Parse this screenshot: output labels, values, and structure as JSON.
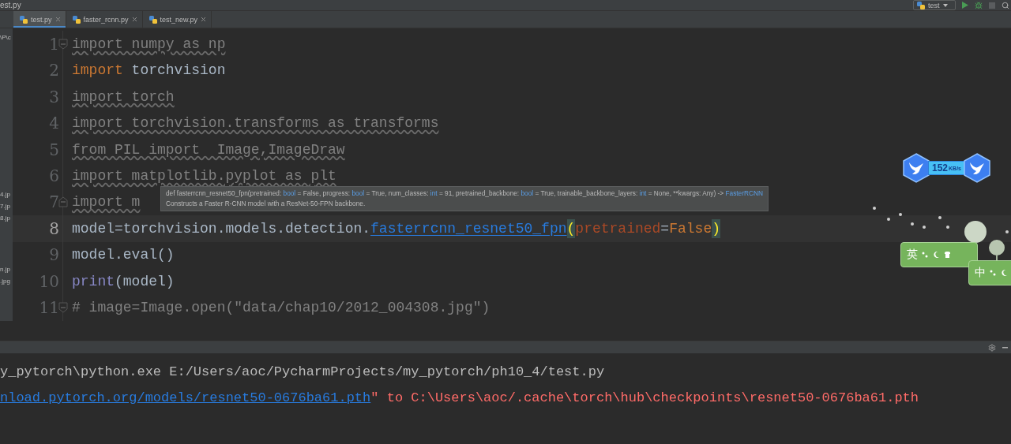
{
  "window": {
    "title": "est.py"
  },
  "run_config": {
    "label": "test"
  },
  "tabs": [
    {
      "label": "test.py",
      "selected": true
    },
    {
      "label": "faster_rcnn.py",
      "selected": false
    },
    {
      "label": "test_new.py",
      "selected": false
    }
  ],
  "project_panel": {
    "items": [
      "\\P\\c",
      "4.jp",
      "7.jp",
      "8.jp",
      "n.jp",
      ".jpg"
    ]
  },
  "editor": {
    "lines": [
      {
        "number": "1",
        "current": false,
        "kind": "opener",
        "tokens": [
          {
            "text": "import numpy as np",
            "kind": "unused"
          }
        ]
      },
      {
        "number": "2",
        "current": false,
        "kind": "line",
        "tokens": [
          {
            "text": "import",
            "kind": "keyword"
          },
          {
            "text": " torchvision",
            "kind": "plain"
          }
        ]
      },
      {
        "number": "3",
        "current": false,
        "kind": "line",
        "tokens": [
          {
            "text": "import torch",
            "kind": "unused"
          }
        ]
      },
      {
        "number": "4",
        "current": false,
        "kind": "line",
        "tokens": [
          {
            "text": "import torchvision.transforms as transforms",
            "kind": "unused"
          }
        ]
      },
      {
        "number": "5",
        "current": false,
        "kind": "line",
        "tokens": [
          {
            "text": "from PIL import  Image,ImageDraw",
            "kind": "unused"
          }
        ]
      },
      {
        "number": "6",
        "current": false,
        "kind": "line",
        "tokens": [
          {
            "text": "import matplotlib.pyplot as plt",
            "kind": "unused"
          }
        ]
      },
      {
        "number": "7",
        "current": false,
        "kind": "closer",
        "tokens": [
          {
            "text": "import m",
            "kind": "unused"
          }
        ]
      },
      {
        "number": "8",
        "current": true,
        "kind": "line",
        "tokens": [
          {
            "text": "model=torchvision.models.detection.",
            "kind": "plain"
          },
          {
            "text": "fasterrcnn_resnet50_fpn",
            "kind": "link"
          },
          {
            "text": "(",
            "kind": "brace"
          },
          {
            "text": "pretrained",
            "kind": "param"
          },
          {
            "text": "=",
            "kind": "plain"
          },
          {
            "text": "False",
            "kind": "keyword"
          },
          {
            "text": ")",
            "kind": "brace"
          }
        ]
      },
      {
        "number": "9",
        "current": false,
        "kind": "line",
        "tokens": [
          {
            "text": "model.eval()",
            "kind": "plain"
          }
        ]
      },
      {
        "number": "10",
        "current": false,
        "kind": "line",
        "tokens": [
          {
            "text": "print",
            "kind": "builtin"
          },
          {
            "text": "(model)",
            "kind": "plain"
          }
        ]
      },
      {
        "number": "11",
        "current": false,
        "kind": "opener",
        "tokens": [
          {
            "text": "# image=Image.open(\"data/chap10/2012_004308.jpg\")",
            "kind": "comment"
          }
        ]
      }
    ]
  },
  "tooltip": {
    "signature": [
      {
        "text": "def fasterrcnn_resnet50_fpn(pretrained: ",
        "kind": "plain"
      },
      {
        "text": "bool",
        "kind": "type"
      },
      {
        "text": " = False, progress: ",
        "kind": "plain"
      },
      {
        "text": "bool",
        "kind": "type"
      },
      {
        "text": " = True, num_classes: ",
        "kind": "plain"
      },
      {
        "text": "int",
        "kind": "type"
      },
      {
        "text": " = 91, pretrained_backbone: ",
        "kind": "plain"
      },
      {
        "text": "bool",
        "kind": "type"
      },
      {
        "text": " = True, trainable_backbone_layers: ",
        "kind": "plain"
      },
      {
        "text": "int",
        "kind": "type"
      },
      {
        "text": " = None, **kwargs: Any) -> ",
        "kind": "plain"
      },
      {
        "text": "FasterRCNN",
        "kind": "type"
      }
    ],
    "description": "Constructs a Faster R-CNN model with a ResNet-50-FPN backbone."
  },
  "console": {
    "lines": [
      [
        {
          "text": "y_pytorch\\python.exe E:/Users/aoc/PycharmProjects/my_pytorch/ph10_4/test.py",
          "kind": "plain"
        }
      ],
      [
        {
          "text": "nload.pytorch.org/models/resnet50-0676ba61.pth",
          "kind": "link"
        },
        {
          "text": "\" to C:\\Users\\aoc/.cache\\torch\\hub\\checkpoints\\resnet50-0676ba61.pth",
          "kind": "error"
        }
      ]
    ]
  },
  "speed_widget": {
    "value": "152",
    "unit": "KB/s"
  },
  "ime": [
    {
      "label": "英"
    },
    {
      "label": "中"
    }
  ]
}
